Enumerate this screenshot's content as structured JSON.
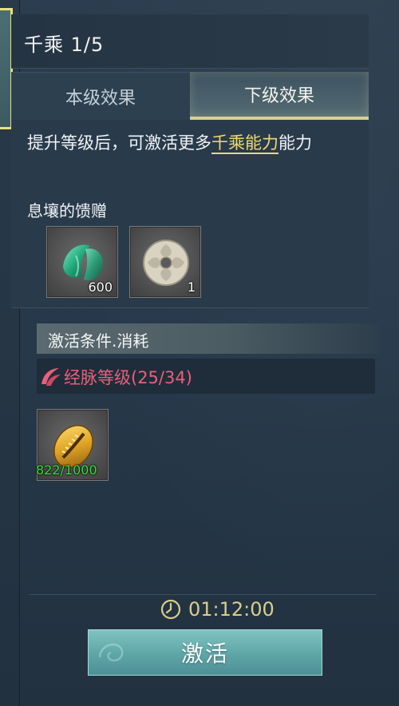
{
  "title": "千乘 1/5",
  "tabs": [
    {
      "label": "本级效果",
      "active": false
    },
    {
      "label": "下级效果",
      "active": true
    }
  ],
  "description": {
    "prefix": "提升等级后，可激活更多",
    "highlight": "千乘能力",
    "suffix": "能力"
  },
  "gift": {
    "label": "息壤的馈赠",
    "items": [
      {
        "icon": "green-jade-icon",
        "count": "600"
      },
      {
        "icon": "white-jade-disc-icon",
        "count": "1"
      }
    ]
  },
  "conditions": {
    "title": "激活条件.消耗",
    "requirement": {
      "icon": "meridian-icon",
      "text": "经脉等级(25/34)"
    },
    "cost_item": {
      "icon": "golden-cowrie-icon",
      "count": "822/1000"
    }
  },
  "timer": {
    "icon": "clock-icon",
    "value": "01:12:00"
  },
  "activate_button": {
    "label": "激活"
  },
  "colors": {
    "highlight": "#f0d874",
    "requirement_text": "#e8607a",
    "count_green": "#35e03b",
    "timer_text": "#d9cf8b",
    "button": "#6db3b3"
  }
}
